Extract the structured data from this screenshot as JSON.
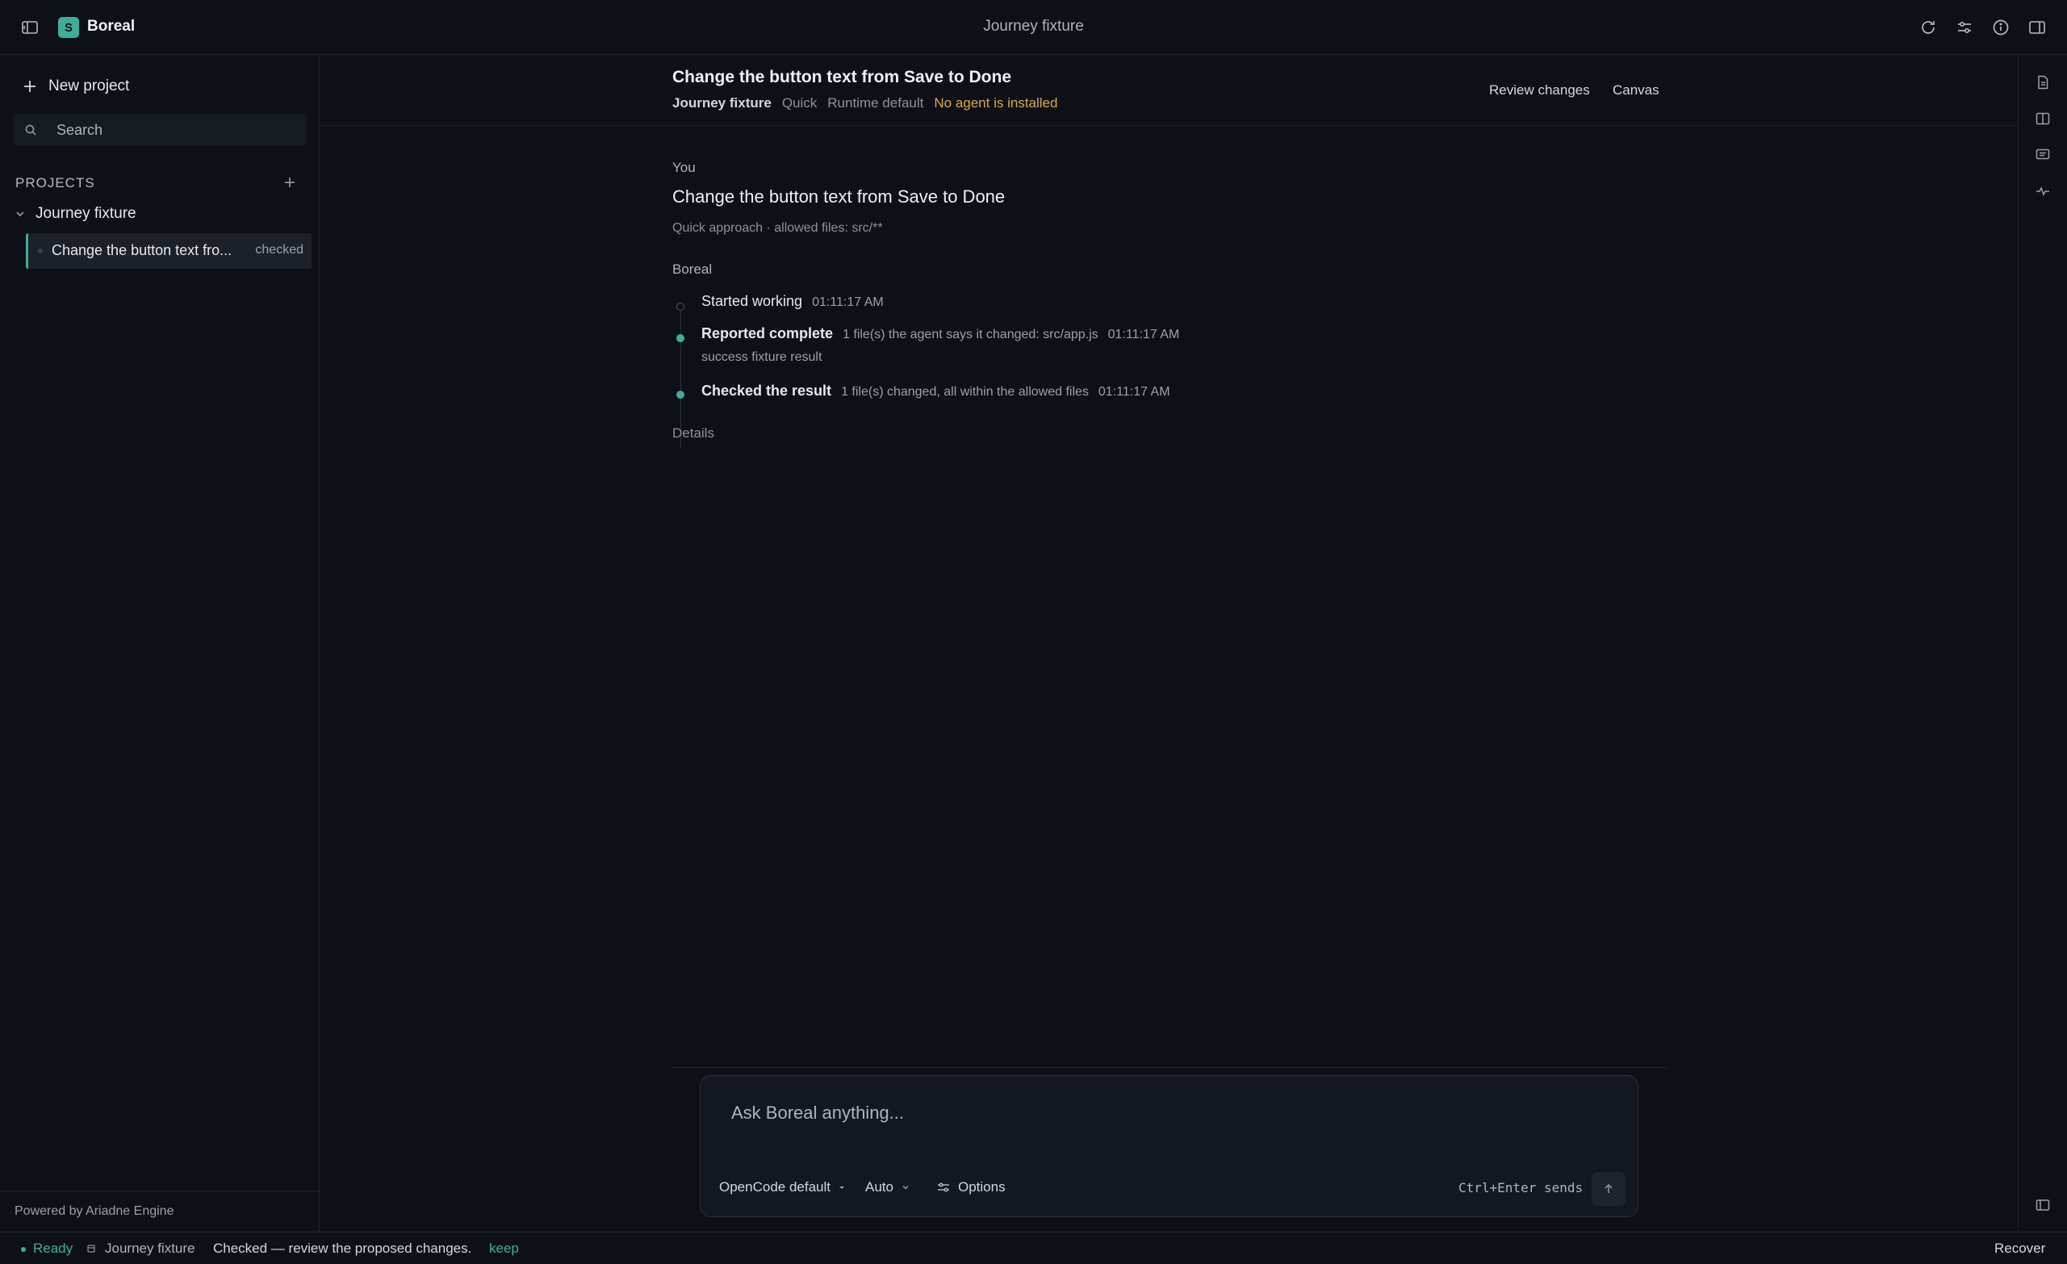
{
  "app": {
    "name": "Boreal",
    "logo_glyph": "S",
    "window_title": "Journey fixture",
    "accent": "#3fae98",
    "warning": "#e0a64a"
  },
  "titlebar": {
    "icons": [
      "sidebar-toggle-icon",
      "refresh-icon",
      "sliders-icon",
      "info-icon",
      "panel-right-icon"
    ]
  },
  "sidebar": {
    "new_project_label": "New project",
    "search_placeholder": "Search",
    "projects_header": "PROJECTS",
    "project": {
      "name": "Journey fixture",
      "expanded": true
    },
    "tasks": [
      {
        "label": "Change the button text fro...",
        "status": "checked",
        "selected": true
      }
    ],
    "footer": "Powered by Ariadne Engine"
  },
  "thread": {
    "title": "Change the button text from Save to Done",
    "meta": {
      "project": "Journey fixture",
      "approach": "Quick",
      "runtime": "Runtime default",
      "warning": "No agent is installed"
    },
    "actions": {
      "review": "Review changes",
      "canvas": "Canvas"
    }
  },
  "messages": {
    "user": {
      "label": "You",
      "text": "Change the button text from Save to Done",
      "meta": "Quick approach · allowed files: src/**"
    },
    "agent": {
      "label": "Boreal",
      "timeline": [
        {
          "title": "Started working",
          "detail": "",
          "time": "01:11:17 AM",
          "state": "pending"
        },
        {
          "title": "Reported complete",
          "detail": "1 file(s) the agent says it changed: src/app.js",
          "time": "01:11:17 AM",
          "sub": "success fixture result",
          "state": "done"
        },
        {
          "title": "Checked the result",
          "detail": "1 file(s) changed, all within the allowed files",
          "time": "01:11:17 AM",
          "state": "done"
        }
      ],
      "details_label": "Details"
    }
  },
  "composer": {
    "placeholder": "Ask Boreal anything...",
    "model": "OpenCode default",
    "mode": "Auto",
    "options_label": "Options",
    "shortcut_hint": "Ctrl+Enter sends"
  },
  "right_rail": {
    "icons": [
      "file-icon",
      "split-view-icon",
      "comment-icon",
      "activity-icon",
      "panel-collapse-icon"
    ]
  },
  "statusbar": {
    "ready": "Ready",
    "project": "Journey fixture",
    "message": "Checked — review the proposed changes.",
    "keep": "keep",
    "recover": "Recover"
  }
}
